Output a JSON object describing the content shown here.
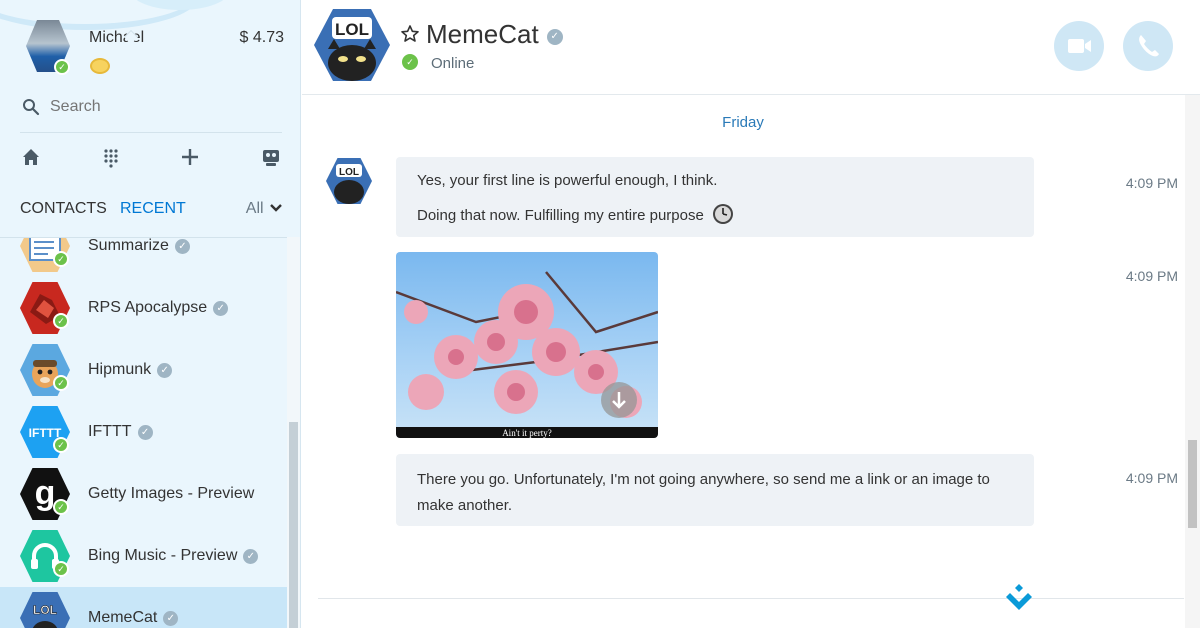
{
  "profile": {
    "name": "Michael",
    "credit": "$ 4.73"
  },
  "search": {
    "placeholder": "Search"
  },
  "tabs": {
    "contacts": "CONTACTS",
    "recent": "RECENT",
    "filter": "All"
  },
  "contacts": [
    {
      "name": "Summarize"
    },
    {
      "name": "RPS Apocalypse"
    },
    {
      "name": "Hipmunk"
    },
    {
      "name": "IFTTT",
      "avatar_text": "IFTTT"
    },
    {
      "name": "Getty Images - Preview",
      "avatar_text": "g"
    },
    {
      "name": "Bing Music - Preview"
    },
    {
      "name": "MemeCat",
      "avatar_text": "LOL"
    }
  ],
  "chat": {
    "title": "MemeCat",
    "status": "Online",
    "avatar_text": "LOL",
    "day": "Friday",
    "messages": [
      {
        "line1": "Yes, your first line is powerful enough, I think.",
        "line2": "Doing that now. Fulfilling my entire purpose",
        "time": "4:09 PM"
      },
      {
        "caption": "Ain't it perty?",
        "time": "4:09 PM"
      },
      {
        "text": "There you go. Unfortunately, I'm not going anywhere, so send me a link or an image to make another.",
        "time": "4:09 PM"
      }
    ]
  },
  "colors": {
    "accent": "#0078d4",
    "presence": "#6cc24a",
    "sidebar_bg": "#eaf6fd",
    "bubble_bg": "#eef2f6"
  }
}
